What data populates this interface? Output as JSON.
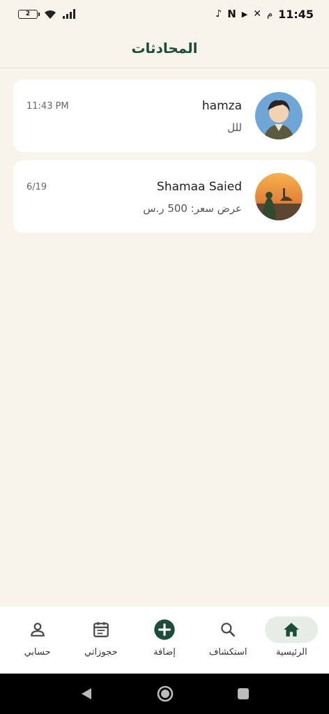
{
  "status": {
    "time": "11:45",
    "rtl_marker": "م",
    "battery": "2"
  },
  "header": {
    "title": "المحادثات"
  },
  "conversations": [
    {
      "name": "hamza",
      "preview": "للل",
      "time": "11:43 PM"
    },
    {
      "name": "Shamaa Saied",
      "preview": "عرض سعر: 500 ر.س",
      "time": "6/19"
    }
  ],
  "nav": {
    "items": [
      {
        "label": "الرئيسية",
        "icon": "home-icon",
        "active": true
      },
      {
        "label": "استكشاف",
        "icon": "search-icon",
        "active": false
      },
      {
        "label": "إضافة",
        "icon": "add-circle-icon",
        "active": false
      },
      {
        "label": "حجوزاتي",
        "icon": "calendar-icon",
        "active": false
      },
      {
        "label": "حسابي",
        "icon": "person-icon",
        "active": false
      }
    ]
  },
  "colors": {
    "accent": "#1b4d3a",
    "background": "#f8f4ec",
    "card": "#ffffff",
    "active_nav": "#e6ece6"
  }
}
